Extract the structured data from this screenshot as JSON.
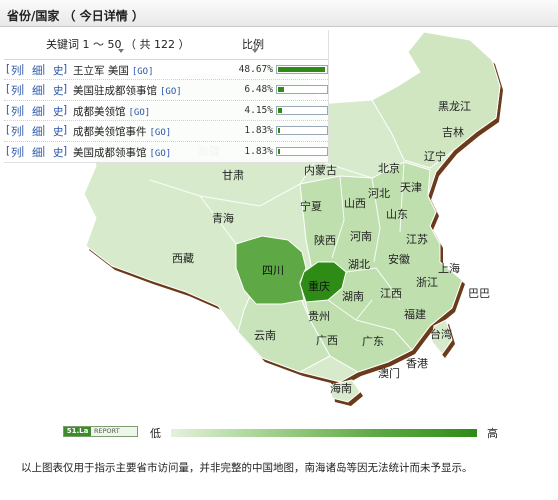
{
  "header": {
    "title": "省份/国家 （ 今日详情 ）"
  },
  "table": {
    "keyword_header": "关键词 1 ～ 50 （ 共 122 ）",
    "ratio_header": "比例",
    "link_labels": [
      "列",
      "细",
      "史"
    ],
    "go_label": "[GO]",
    "rows": [
      {
        "keyword": "王立军 美国",
        "percent": "48.67%",
        "share": 0.4867
      },
      {
        "keyword": "美国驻成都领事馆",
        "percent": "6.48%",
        "share": 0.0648
      },
      {
        "keyword": "成都美领馆",
        "percent": "4.15%",
        "share": 0.0415
      },
      {
        "keyword": "成都美领馆事件",
        "percent": "1.83%",
        "share": 0.0183
      },
      {
        "keyword": "美国成都领事馆",
        "percent": "1.83%",
        "share": 0.0183
      }
    ]
  },
  "map": {
    "provinces": [
      "新疆",
      "西藏",
      "青海",
      "甘肃",
      "内蒙古",
      "宁夏",
      "陕西",
      "山西",
      "河北",
      "北京",
      "天津",
      "辽宁",
      "吉林",
      "黑龙江",
      "山东",
      "河南",
      "湖北",
      "江苏",
      "安徽",
      "上海",
      "浙江",
      "四川",
      "重庆",
      "湖南",
      "江西",
      "贵州",
      "云南",
      "广西",
      "广东",
      "福建",
      "台湾",
      "香港",
      "澳门",
      "海南",
      "巴巴"
    ],
    "highlighted": {
      "dark": "重庆",
      "medium": "四川"
    },
    "colors": {
      "dark": "#2e8b16",
      "medium": "#5fa846",
      "light": "#bfe0ae",
      "pale": "#d7ebcc",
      "shadow": "#6b3a1a"
    }
  },
  "legend": {
    "badge_logo": "51.La",
    "badge_text": "REPORT",
    "low": "低",
    "high": "高",
    "colors": {
      "start": "#e4f1dc",
      "end": "#2e8b16"
    }
  },
  "footnote": "以上图表仅用于指示主要省市访问量，并非完整的中国地图，南海诸岛等因无法统计而未予显示。"
}
